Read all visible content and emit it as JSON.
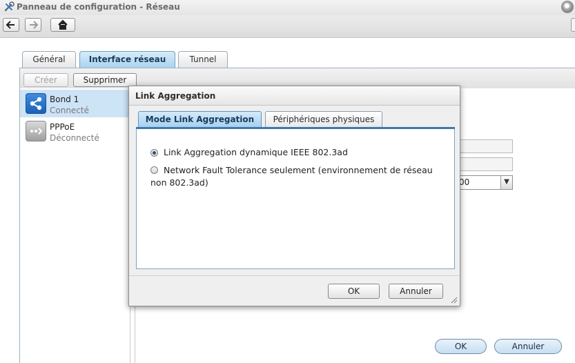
{
  "window": {
    "title": "Panneau de configuration - Réseau"
  },
  "toolbar": {
    "back_icon": "arrow-left-icon",
    "forward_icon": "arrow-right-icon",
    "home_icon": "home-icon"
  },
  "main_tabs": [
    {
      "label": "Général",
      "active": false
    },
    {
      "label": "Interface réseau",
      "active": true
    },
    {
      "label": "Tunnel",
      "active": false
    }
  ],
  "actions": {
    "create_label": "Créer",
    "delete_label": "Supprimer"
  },
  "interfaces": [
    {
      "name": "Bond 1",
      "status": "Connecté",
      "selected": true,
      "icon": "bond-share-icon"
    },
    {
      "name": "PPPoE",
      "status": "Déconnecté",
      "selected": false,
      "icon": "pppoe-connection-icon"
    }
  ],
  "background_form": {
    "select_value_partial": "00"
  },
  "main_buttons": {
    "ok_label": "OK",
    "cancel_label": "Annuler"
  },
  "dialog": {
    "title": "Link Aggregation",
    "tabs": [
      {
        "label": "Mode Link Aggregation",
        "active": true
      },
      {
        "label": "Périphériques physiques",
        "active": false
      }
    ],
    "options": [
      {
        "label": "Link Aggregation dynamique IEEE 802.3ad",
        "checked": true
      },
      {
        "label": "Network Fault Tolerance seulement (environnement de réseau non 802.3ad)",
        "checked": false
      }
    ],
    "ok_label": "OK",
    "cancel_label": "Annuler"
  },
  "colors": {
    "accent": "#a9d2ee",
    "selection": "#cde3f6",
    "bond_icon": "#2a78d0"
  }
}
